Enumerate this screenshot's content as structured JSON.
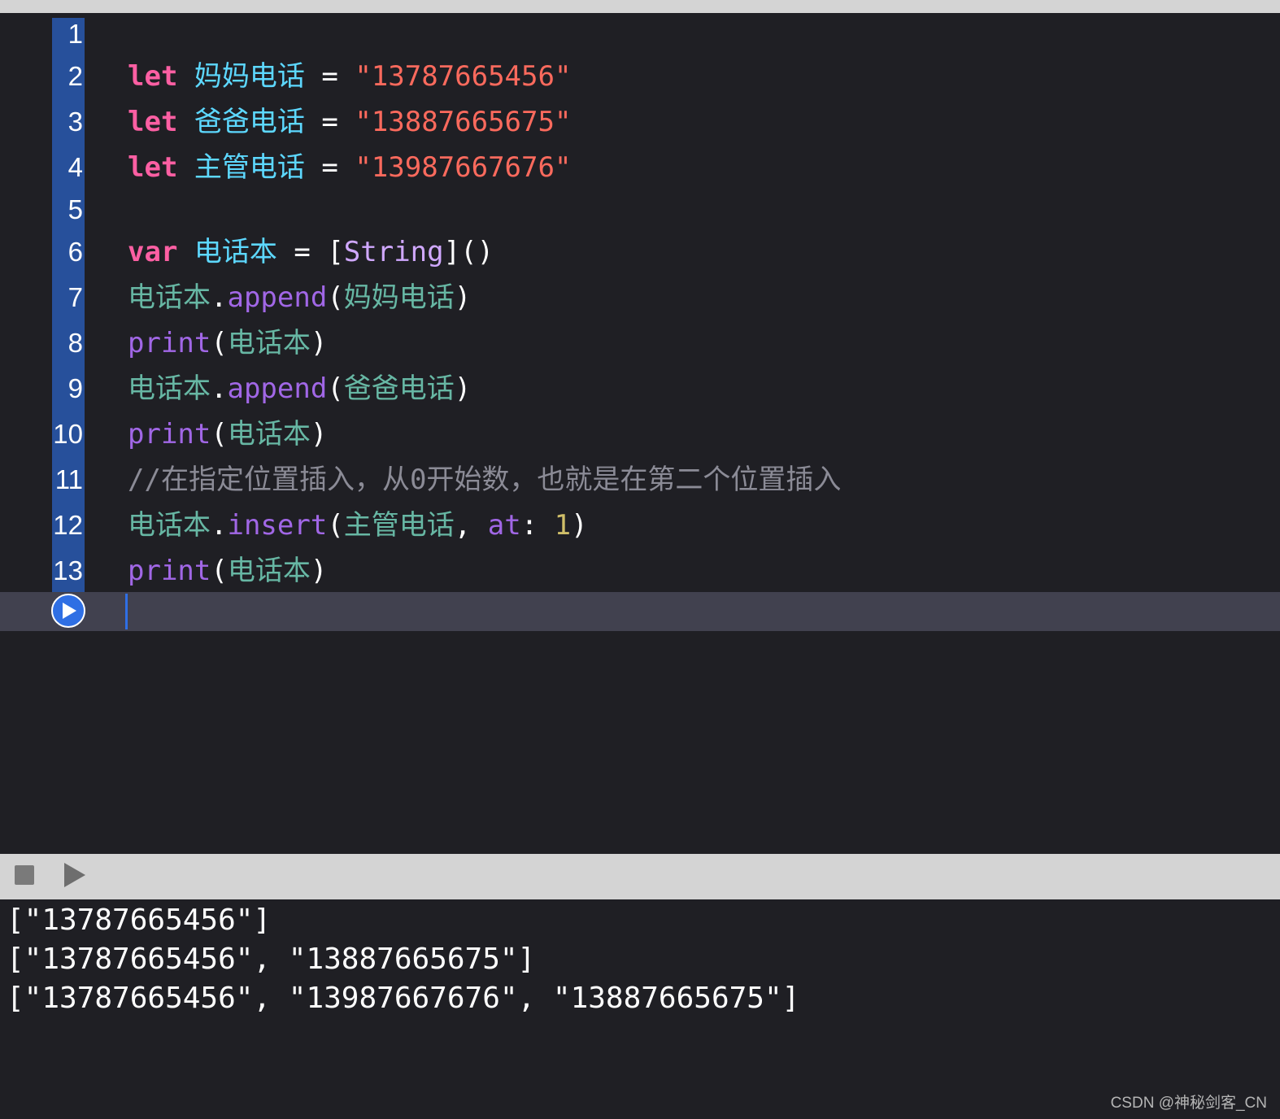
{
  "editor": {
    "line_numbers": [
      "1",
      "2",
      "3",
      "4",
      "5",
      "6",
      "7",
      "8",
      "9",
      "10",
      "11",
      "12",
      "13"
    ],
    "lines": {
      "l2": {
        "kw": "let",
        "name": "妈妈电话",
        "eq": " = ",
        "value": "\"13787665456\""
      },
      "l3": {
        "kw": "let",
        "name": "爸爸电话",
        "eq": " = ",
        "value": "\"13887665675\""
      },
      "l4": {
        "kw": "let",
        "name": "主管电话",
        "eq": " = ",
        "value": "\"13987667676\""
      },
      "l6": {
        "kw": "var",
        "name": "电话本",
        "eq": " = [",
        "type": "String",
        "tail": "]()"
      },
      "l7": {
        "obj": "电话本",
        "dot": ".",
        "method": "append",
        "open": "(",
        "arg": "妈妈电话",
        "close": ")"
      },
      "l8": {
        "fn": "print",
        "open": "(",
        "arg": "电话本",
        "close": ")"
      },
      "l9": {
        "obj": "电话本",
        "dot": ".",
        "method": "append",
        "open": "(",
        "arg": "爸爸电话",
        "close": ")"
      },
      "l10": {
        "fn": "print",
        "open": "(",
        "arg": "电话本",
        "close": ")"
      },
      "l11": {
        "comment": "//在指定位置插入，从0开始数，也就是在第二个位置插入"
      },
      "l12": {
        "obj": "电话本",
        "dot": ".",
        "method": "insert",
        "open": "(",
        "arg": "主管电话",
        "comma": ", ",
        "label": "at",
        "colon": ": ",
        "num": "1",
        "close": ")"
      },
      "l13": {
        "fn": "print",
        "open": "(",
        "arg": "电话本",
        "close": ")"
      }
    },
    "run_icon": "play-circle-icon"
  },
  "toolbar": {
    "stop_icon": "stop-icon",
    "play_icon": "play-icon"
  },
  "console": {
    "output": [
      "[\"13787665456\"]",
      "[\"13787665456\", \"13887665675\"]",
      "[\"13787665456\", \"13987667676\", \"13887665675\"]"
    ]
  },
  "watermark": "CSDN @神秘剑客_CN",
  "colors": {
    "background": "#1f1f24",
    "gutter_highlight": "#27509b",
    "keyword": "#fc5fa3",
    "identifier": "#5dd8ff",
    "string": "#fc6a5d",
    "method": "#a167e6",
    "variable": "#67b7a4",
    "comment": "#8b8b96",
    "number": "#d0bf69"
  }
}
